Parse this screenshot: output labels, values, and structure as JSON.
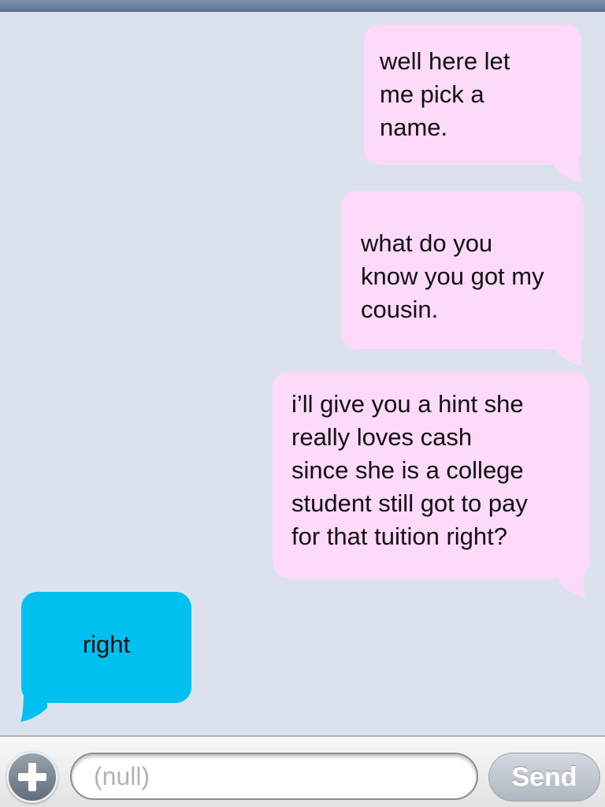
{
  "thread": {
    "messages": [
      {
        "direction": "outgoing",
        "text": "well here let\nme pick a\nname."
      },
      {
        "direction": "outgoing",
        "text": "what do you\nknow you got my\ncousin."
      },
      {
        "direction": "outgoing",
        "text": "i’ll give you a hint she\nreally loves cash\nsince she is a college\nstudent still got to pay\nfor that tuition right?"
      },
      {
        "direction": "incoming",
        "text": "right"
      }
    ]
  },
  "composer": {
    "add_icon": "plus-circle-icon",
    "placeholder": "(null)",
    "value": "",
    "send_label": "Send"
  },
  "colors": {
    "outgoing_bubble": "#fdd9fa",
    "incoming_bubble": "#00c0f0",
    "background": "#dbe2ed"
  }
}
